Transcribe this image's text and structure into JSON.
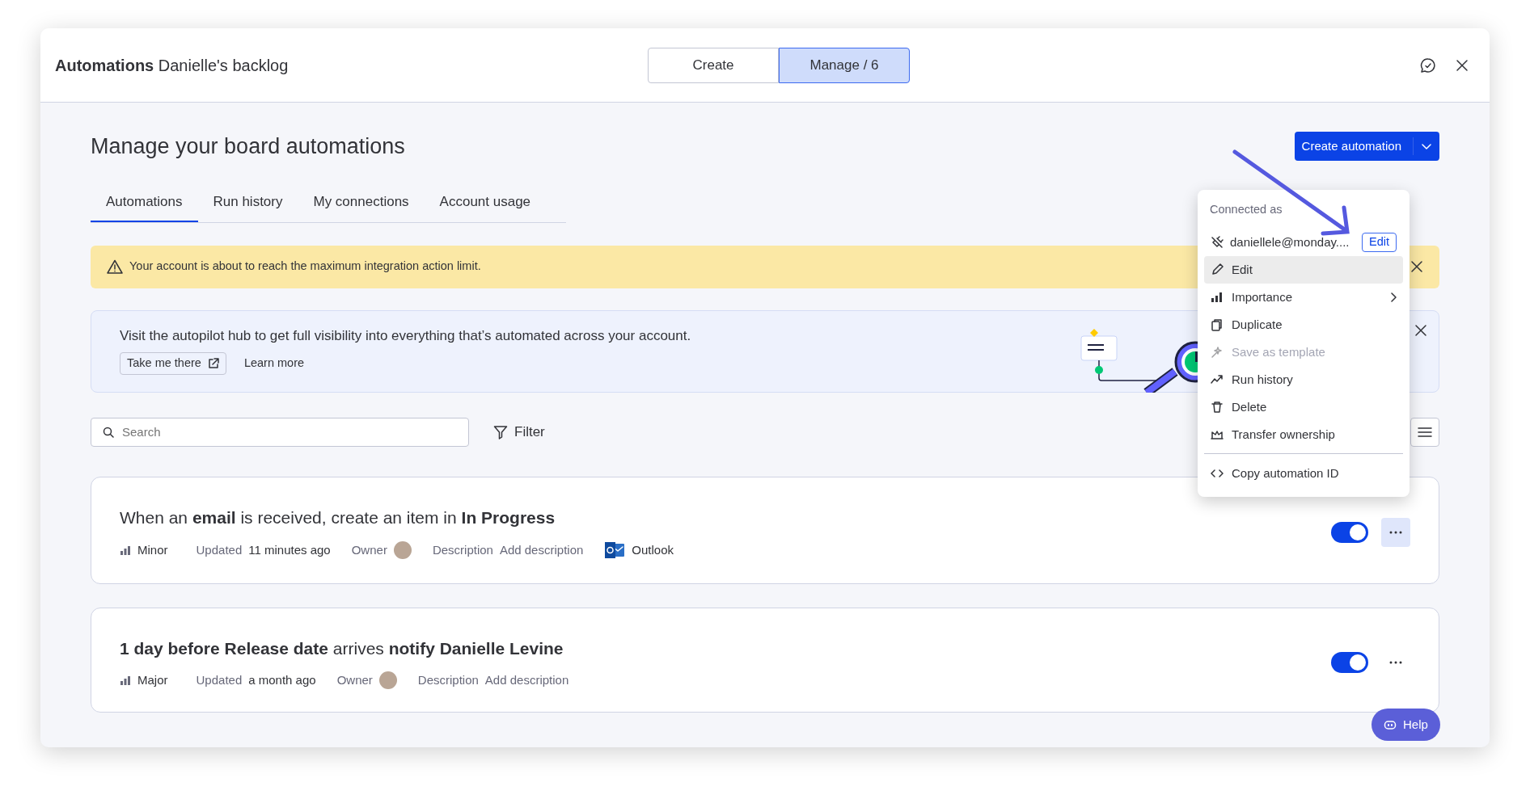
{
  "header": {
    "title_bold": "Automations",
    "title": "Danielle's backlog",
    "segments": [
      {
        "label": "Create",
        "selected": false
      },
      {
        "label": "Manage / 6",
        "selected": true
      }
    ]
  },
  "page": {
    "heading": "Manage your board automations",
    "create_button": "Create automation"
  },
  "tabs": [
    {
      "label": "Automations",
      "selected": true
    },
    {
      "label": "Run history",
      "selected": false
    },
    {
      "label": "My connections",
      "selected": false
    },
    {
      "label": "Account usage",
      "selected": false
    }
  ],
  "warning_banner": {
    "text": "Your account is about to reach the maximum integration action limit."
  },
  "hub_banner": {
    "text": "Visit the autopilot hub to get full visibility into everything that’s automated across your account.",
    "primary_link": "Take me there",
    "secondary_link": "Learn more"
  },
  "search": {
    "placeholder": "Search"
  },
  "filter": "Filter",
  "automations": [
    {
      "title": "When an **email** is received, create an item in **In Progress**",
      "importance": "Minor",
      "updated_label": "Updated",
      "updated": "11 minutes ago",
      "owner_label": "Owner",
      "description_label": "Description",
      "description": "Add description",
      "integration": "Outlook",
      "on": true,
      "menu_open": true
    },
    {
      "title": "**1 day before Release date** arrives **notify Danielle Levine**",
      "importance": "Major",
      "updated_label": "Updated",
      "updated": "a month ago",
      "owner_label": "Owner",
      "description_label": "Description",
      "description": "Add description",
      "on": true,
      "menu_open": false
    }
  ],
  "context_menu": {
    "header": "Connected as",
    "account": "daniellele@monday....",
    "account_action": "Edit",
    "items": [
      {
        "label": "Edit",
        "selected": true,
        "disabled": false,
        "submenu": false,
        "divider_before": false
      },
      {
        "label": "Importance",
        "selected": false,
        "disabled": false,
        "submenu": true,
        "divider_before": false
      },
      {
        "label": "Duplicate",
        "selected": false,
        "disabled": false,
        "submenu": false,
        "divider_before": false
      },
      {
        "label": "Save as template",
        "selected": false,
        "disabled": true,
        "submenu": false,
        "divider_before": false
      },
      {
        "label": "Run history",
        "selected": false,
        "disabled": false,
        "submenu": false,
        "divider_before": false
      },
      {
        "label": "Delete",
        "selected": false,
        "disabled": false,
        "submenu": false,
        "divider_before": false
      },
      {
        "label": "Transfer ownership",
        "selected": false,
        "disabled": false,
        "submenu": false,
        "divider_before": false
      },
      {
        "label": "Copy automation ID",
        "selected": false,
        "disabled": false,
        "submenu": false,
        "divider_before": true
      }
    ]
  },
  "help_button": "Help"
}
